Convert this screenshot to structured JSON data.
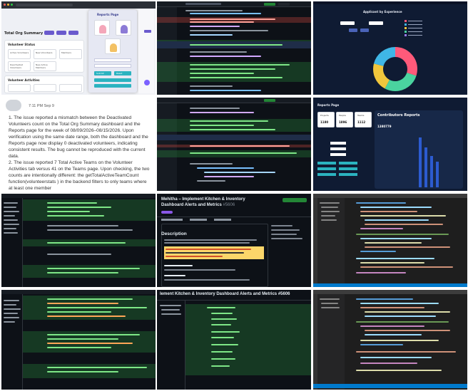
{
  "tiles": {
    "t0": {
      "page_title": "Total Org Summary",
      "popup_title": "Reports Page",
      "volunteer_status": "Volunteer Status",
      "volunteer_activities": "Volunteer Activities",
      "cards": [
        "Active Volunteers",
        "New Volunteers",
        "Members",
        "Deactivated Volunteers",
        "New Active Members"
      ],
      "buttons": [
        "Submit",
        "Reset"
      ]
    },
    "t2": {
      "title": "Applicant by Experience"
    },
    "t3": {
      "time": "7:11 PM Sep 9",
      "paragraph1": "1. The issue reported a mismatch between the Deactivated Volunteers count on the Total Org Summary dashboard and the Reports page for the week of 08/09/2026–08/15/2026. Upon verification using the same date range, both the dashboard and the Reports page now display 0 deactivated volunteers, indicating consistent results. The bug cannot be reproduced with the current data.",
      "paragraph2": "2. The issue reported 7 Total Active Teams on the Volunteer Activities tab versus 41 on the Teams page. Upon checking, the two counts are intentionally different: the getTotalActiveTeamCount function(volunteerstats ) in the backend filters to only teams where at least one member"
    },
    "t5": {
      "title": "Reports Page",
      "stats": [
        {
          "label": "Projects",
          "value": "1180"
        },
        {
          "label": "People",
          "value": "1896"
        },
        {
          "label": "Teams",
          "value": "1112"
        }
      ],
      "contrib_title": "Contributors Reports",
      "contrib_value": "1380779"
    },
    "t7": {
      "title": "Mehitha – Implement Kitchen & Inventory Dashboard Alerts and Metrics",
      "pr_number": "#5606",
      "description": "Description"
    },
    "t10": {
      "title": "lement Kitchen & Inventory Dashboard Alerts and Metrics #5606"
    }
  }
}
